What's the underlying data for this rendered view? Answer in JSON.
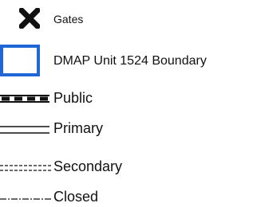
{
  "legend": {
    "items": [
      {
        "key": "gates",
        "label": "Gates",
        "icon": "x-mark-icon",
        "color": "#111111"
      },
      {
        "key": "boundary",
        "label": "DMAP Unit 1524 Boundary",
        "icon": "boundary-box-icon",
        "color": "#1f66d6"
      },
      {
        "key": "public",
        "label": "Public",
        "icon": "dashed-thick-line-icon",
        "color": "#111111"
      },
      {
        "key": "primary",
        "label": "Primary",
        "icon": "double-line-icon",
        "color": "#111111"
      },
      {
        "key": "secondary",
        "label": "Secondary",
        "icon": "dashed-double-line-icon",
        "color": "#111111"
      },
      {
        "key": "closed",
        "label": "Closed",
        "icon": "dash-dot-line-icon",
        "color": "#111111"
      }
    ]
  }
}
